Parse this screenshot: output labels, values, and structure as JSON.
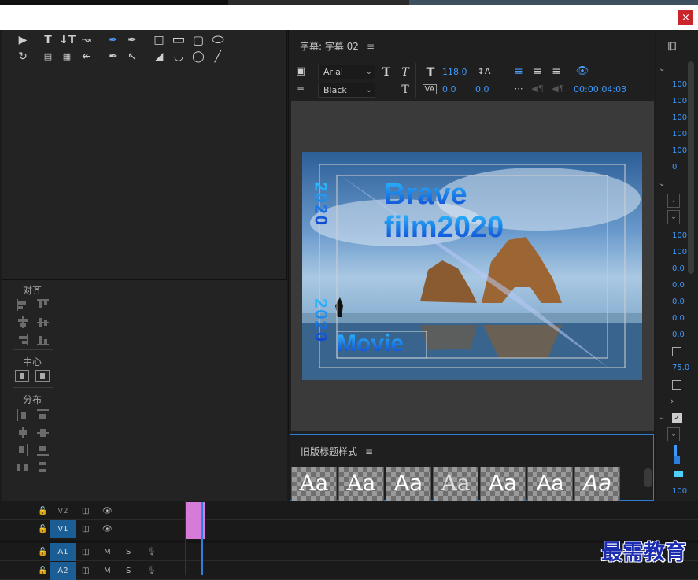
{
  "window": {
    "close_label": "×"
  },
  "editor": {
    "panel_title": "字幕: 字幕 02",
    "font_family": "Arial",
    "font_style": "Black",
    "font_size": "118.0",
    "kerning": "0.0",
    "leading": "0.0",
    "timecode": "00:00:04:03"
  },
  "canvas": {
    "vertical_text_1": "2020",
    "vertical_text_2": "2020",
    "title_line1": "Brave",
    "title_line2": "film2020",
    "subtitle": "Movie"
  },
  "align_panel": {
    "section_align": "对齐",
    "section_center": "中心",
    "section_distribute": "分布"
  },
  "styles_panel": {
    "title": "旧版标题样式",
    "sample_label": "Aa"
  },
  "right_panel": {
    "title": "旧",
    "values": [
      "100",
      "100",
      "100",
      "100",
      "100",
      "0",
      "100",
      "100",
      "0.0",
      "0.0",
      "0.0",
      "0.0",
      "0.0",
      "75.0",
      "100"
    ]
  },
  "timeline": {
    "tracks": [
      "V2",
      "V1",
      "A1",
      "A2"
    ],
    "mute_label": "M",
    "solo_label": "S"
  },
  "watermark": "最需教育"
}
